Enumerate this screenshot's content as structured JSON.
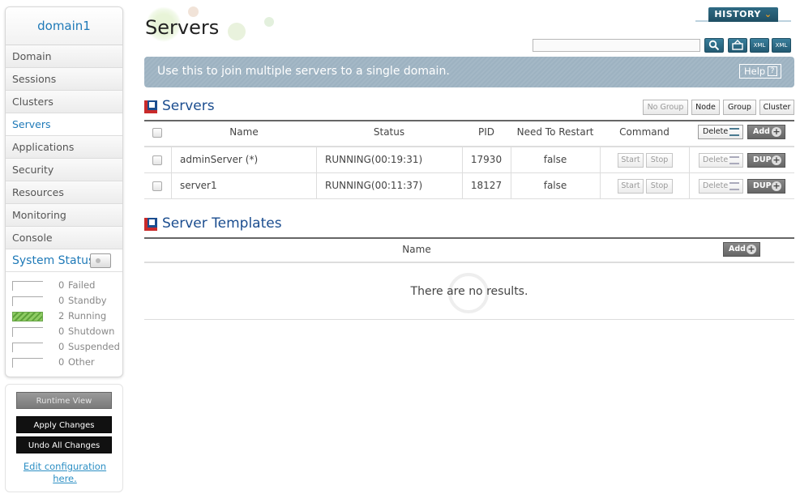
{
  "sidebar": {
    "title": "domain1",
    "items": [
      {
        "label": "Domain"
      },
      {
        "label": "Sessions"
      },
      {
        "label": "Clusters"
      },
      {
        "label": "Servers"
      },
      {
        "label": "Applications"
      },
      {
        "label": "Security"
      },
      {
        "label": "Resources"
      },
      {
        "label": "Monitoring"
      },
      {
        "label": "Console"
      }
    ],
    "active_item": "Servers",
    "system_status": {
      "title": "System Status",
      "rows": [
        {
          "count": "0",
          "label": "Failed"
        },
        {
          "count": "0",
          "label": "Standby"
        },
        {
          "count": "2",
          "label": "Running"
        },
        {
          "count": "0",
          "label": "Shutdown"
        },
        {
          "count": "0",
          "label": "Suspended"
        },
        {
          "count": "0",
          "label": "Other"
        }
      ]
    },
    "actions": {
      "runtime_view": "Runtime View",
      "apply_changes": "Apply Changes",
      "undo_all_changes": "Undo All Changes",
      "edit_link_line1": "Edit configuration",
      "edit_link_line2": "here."
    }
  },
  "header": {
    "title": "Servers",
    "history_label": "HISTORY",
    "search": {
      "value": "",
      "placeholder": ""
    },
    "tools": [
      "search-icon",
      "refresh-icon",
      "xml-export-icon",
      "xml-import-icon"
    ],
    "tool_labels": {
      "xml1": "XML",
      "xml2": "XML"
    }
  },
  "banner": {
    "text": "Use this to join multiple servers to a single domain.",
    "help_label": "Help",
    "help_q": "?"
  },
  "servers_section": {
    "title": "Servers",
    "filters": [
      "No Group",
      "Node",
      "Group",
      "Cluster"
    ],
    "columns": {
      "name": "Name",
      "status": "Status",
      "pid": "PID",
      "restart": "Need To Restart",
      "command": "Command"
    },
    "header_buttons": {
      "delete": "Delete",
      "add": "Add"
    },
    "row_buttons": {
      "start": "Start",
      "stop": "Stop",
      "delete": "Delete",
      "dup": "DUP"
    },
    "rows": [
      {
        "name": "adminServer (*)",
        "status": "RUNNING(00:19:31)",
        "pid": "17930",
        "restart": "false"
      },
      {
        "name": "server1",
        "status": "RUNNING(00:11:37)",
        "pid": "18127",
        "restart": "false"
      }
    ]
  },
  "templates_section": {
    "title": "Server Templates",
    "column_name": "Name",
    "add_label": "Add",
    "empty_text": "There are no results."
  },
  "colors": {
    "accent": "#1f7ab8",
    "section_blue": "#1b4d8f",
    "section_red": "#c92a2a",
    "banner": "#a4b8c6",
    "running": "#8ecb63"
  }
}
